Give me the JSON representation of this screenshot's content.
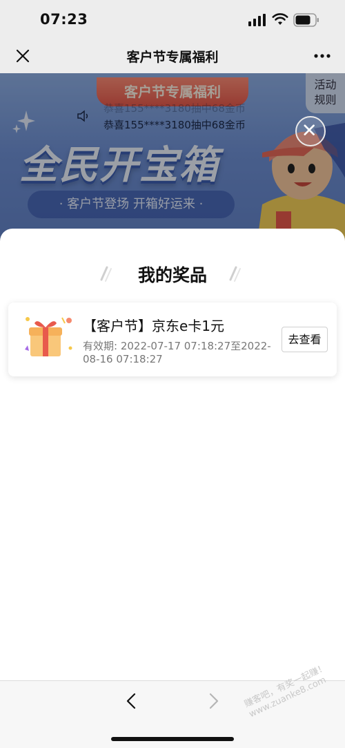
{
  "status_bar": {
    "time": "07:23"
  },
  "nav": {
    "title": "客户节专属福利"
  },
  "banner": {
    "tag": "客户节专属福利",
    "rules_line1": "活动",
    "rules_line2": "规则",
    "ticker_partial": "恭喜155****3180抽中68金币",
    "ticker": "恭喜155****3180抽中68金币",
    "headline": "全民开宝箱",
    "subline": "· 客户节登场 开箱好运来 ·"
  },
  "sheet": {
    "title": "我的奖品",
    "prizes": [
      {
        "name": "【客户节】京东e卡1元",
        "validity": "有效期: 2022-07-17 07:18:27至2022-08-16 07:18:27",
        "action": "去查看"
      }
    ]
  },
  "watermark": {
    "line1": "赚客吧，有奖一起赚！",
    "line2": "www.zuanke8.com"
  }
}
